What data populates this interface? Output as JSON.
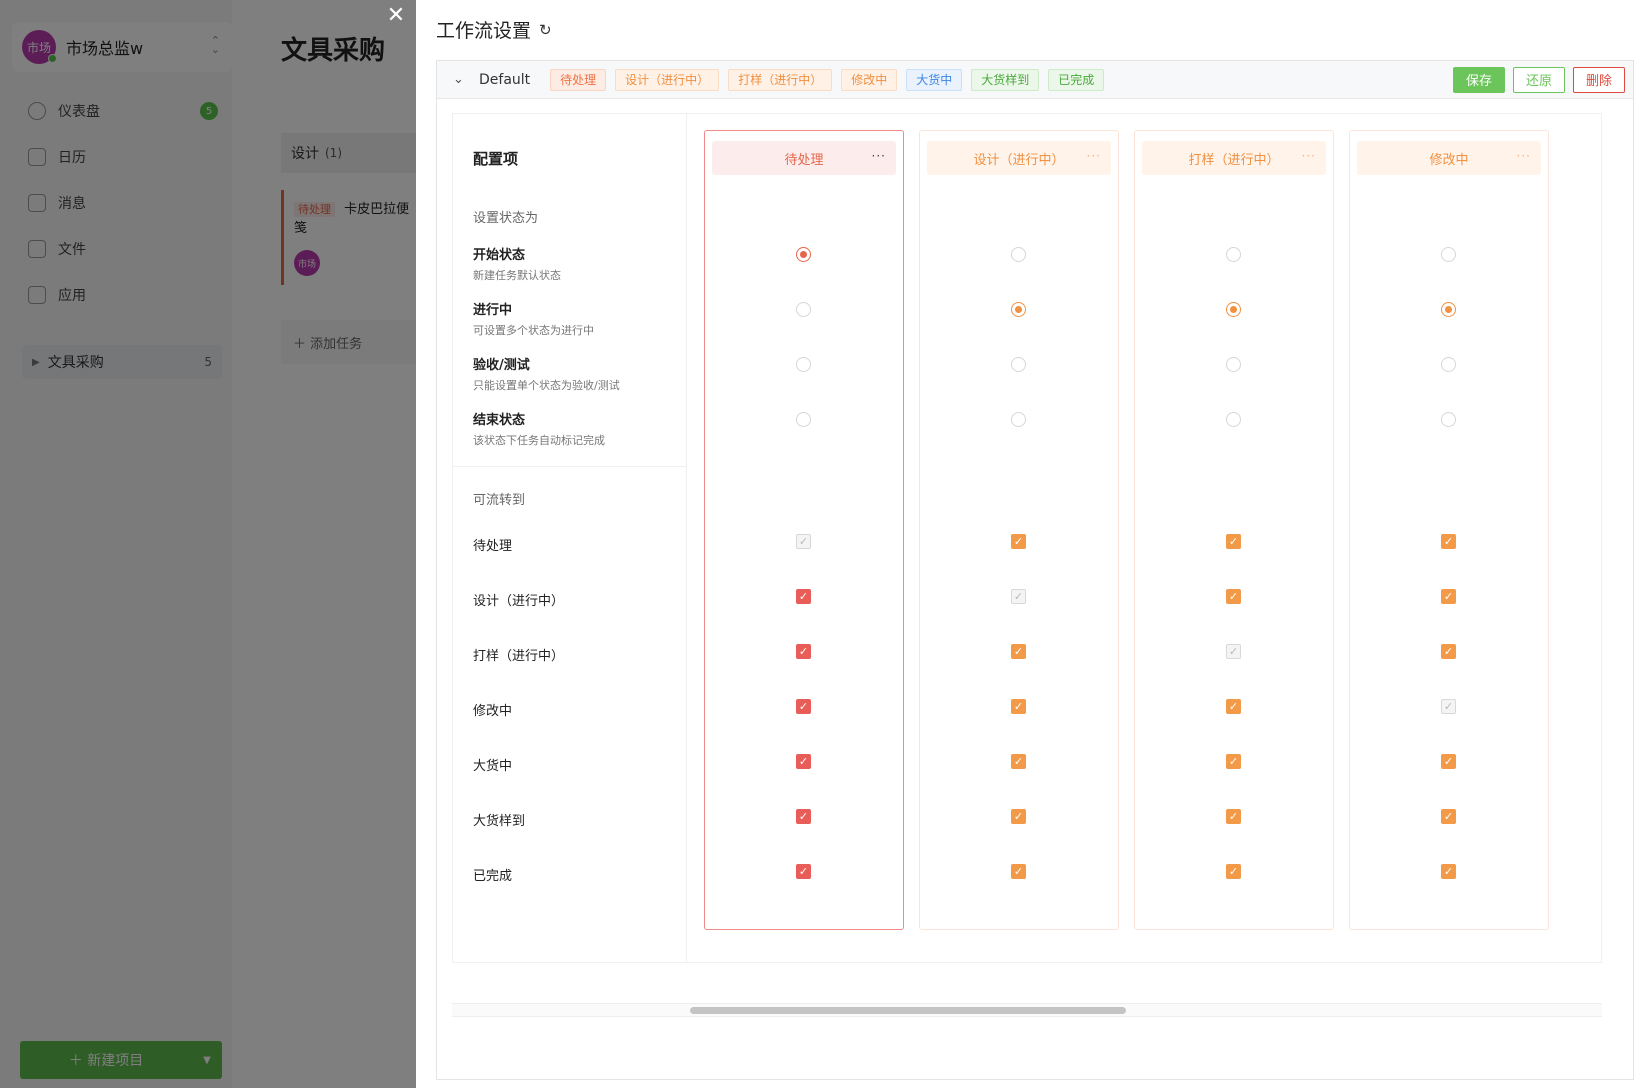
{
  "sidebar": {
    "user": {
      "avatar_text": "市场",
      "name": "市场总监w"
    },
    "nav": [
      {
        "label": "仪表盘",
        "icon": "dashboard-icon",
        "badge": "5"
      },
      {
        "label": "日历",
        "icon": "calendar-icon"
      },
      {
        "label": "消息",
        "icon": "message-icon"
      },
      {
        "label": "文件",
        "icon": "file-icon"
      },
      {
        "label": "应用",
        "icon": "apps-icon"
      }
    ],
    "project": {
      "label": "文具采购",
      "count": "5"
    },
    "new_project": "＋ 新建项目"
  },
  "board": {
    "title": "文具采购",
    "column": {
      "label": "设计",
      "count": "(1)"
    },
    "card": {
      "tag": "待处理",
      "title": "卡皮巴拉便笺",
      "avatar_text": "市场"
    },
    "add_task": "＋ 添加任务"
  },
  "drawer": {
    "title": "工作流设置",
    "workflow": {
      "name": "Default",
      "chips": [
        {
          "label": "待处理",
          "style": "pending"
        },
        {
          "label": "设计（进行中）",
          "style": "orange"
        },
        {
          "label": "打样（进行中）",
          "style": "orange"
        },
        {
          "label": "修改中",
          "style": "orange"
        },
        {
          "label": "大货中",
          "style": "blue"
        },
        {
          "label": "大货样到",
          "style": "green"
        },
        {
          "label": "已完成",
          "style": "green"
        }
      ],
      "actions": {
        "save": "保存",
        "restore": "还原",
        "delete": "删除"
      }
    },
    "matrix": {
      "config_title": "配置项",
      "set_state_section": "设置状态为",
      "state_types": [
        {
          "label": "开始状态",
          "desc": "新建任务默认状态"
        },
        {
          "label": "进行中",
          "desc": "可设置多个状态为进行中"
        },
        {
          "label": "验收/测试",
          "desc": "只能设置单个状态为验收/测试"
        },
        {
          "label": "结束状态",
          "desc": "该状态下任务自动标记完成"
        }
      ],
      "transition_section": "可流转到",
      "transition_targets": [
        "待处理",
        "设计（进行中）",
        "打样（进行中）",
        "修改中",
        "大货中",
        "大货样到",
        "已完成"
      ],
      "columns": [
        {
          "label": "待处理",
          "state_type": 0,
          "disabled_target": 0,
          "color": "red",
          "active": true
        },
        {
          "label": "设计（进行中）",
          "state_type": 1,
          "disabled_target": 1,
          "color": "orange",
          "active": false
        },
        {
          "label": "打样（进行中）",
          "state_type": 1,
          "disabled_target": 2,
          "color": "orange",
          "active": false
        },
        {
          "label": "修改中",
          "state_type": 1,
          "disabled_target": 3,
          "color": "orange",
          "active": false
        }
      ]
    }
  },
  "colors": {
    "accent_red": "#e5664b",
    "accent_orange": "#f09040",
    "success_green": "#6cc55a",
    "danger_red": "#e04a3c"
  }
}
